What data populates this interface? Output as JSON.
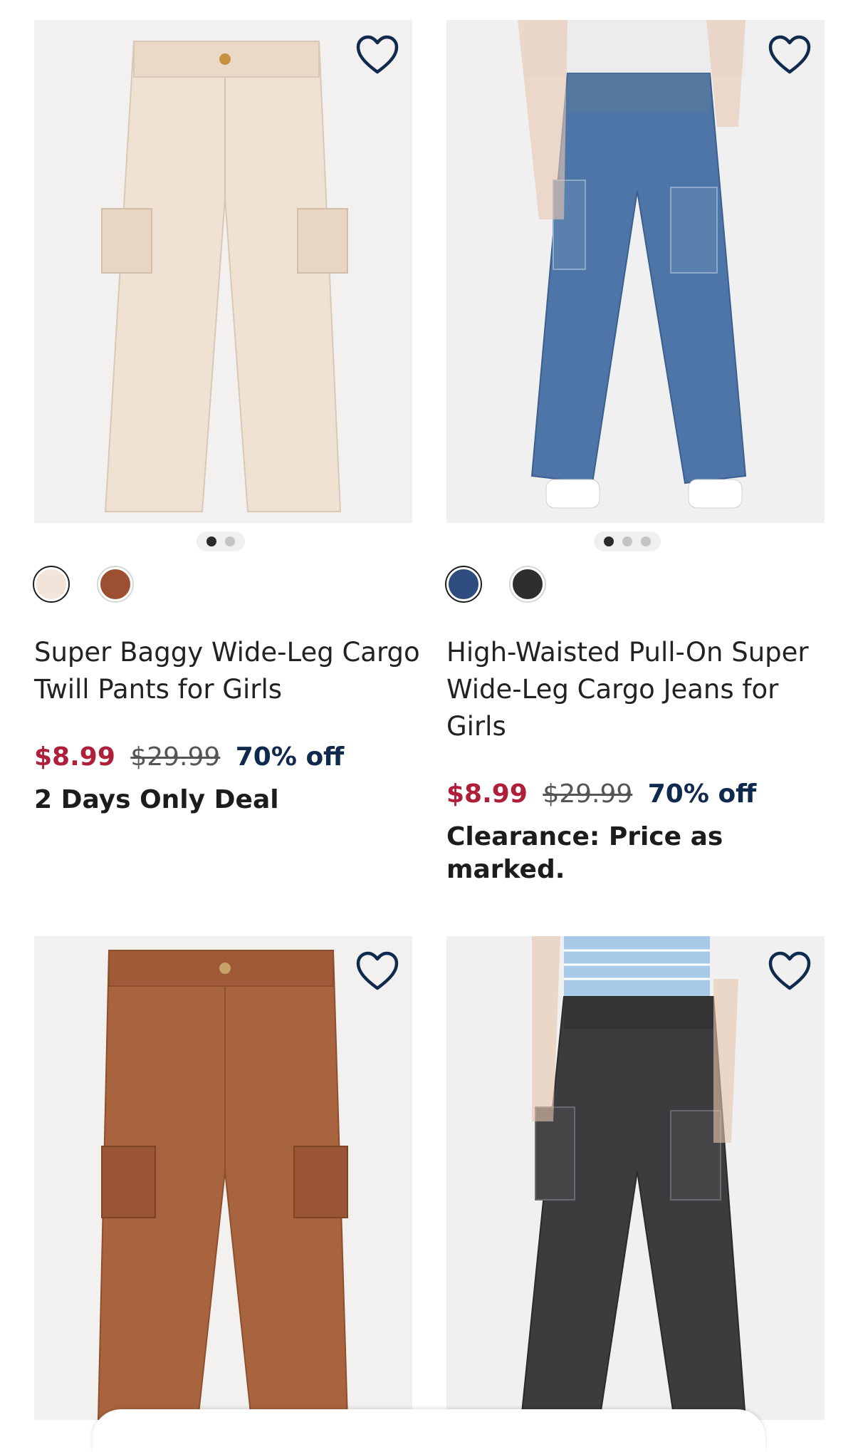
{
  "products": [
    {
      "title": "Super Baggy Wide-Leg Cargo Twill Pants for Girls",
      "sale_price": "$8.99",
      "original_price": "$29.99",
      "discount": "70% off",
      "promo": "2 Days Only Deal",
      "favorite_icon": "heart-outline-icon",
      "image_dots": 2,
      "active_dot": 1,
      "swatch_colors": [
        "#f2e4d9",
        "#9c5031"
      ],
      "selected_swatch": 1,
      "product_color": "#efe2d3"
    },
    {
      "title": "High-Waisted Pull-On Super Wide-Leg Cargo Jeans for Girls",
      "sale_price": "$8.99",
      "original_price": "$29.99",
      "discount": "70% off",
      "promo": "Clearance: Price as marked.",
      "favorite_icon": "heart-outline-icon",
      "image_dots": 3,
      "active_dot": 1,
      "swatch_colors": [
        "#2e4c7d",
        "#2e2e2e"
      ],
      "selected_swatch": 1,
      "product_color": "#4e75a8"
    },
    {
      "favorite_icon": "heart-outline-icon",
      "product_color": "#a8643f"
    },
    {
      "favorite_icon": "heart-outline-icon",
      "product_color": "#3c3c3e"
    }
  ],
  "colors": {
    "sale_price": "#b01f3a",
    "discount": "#0f2a4d",
    "heart_outline": "#0f2a4d"
  }
}
